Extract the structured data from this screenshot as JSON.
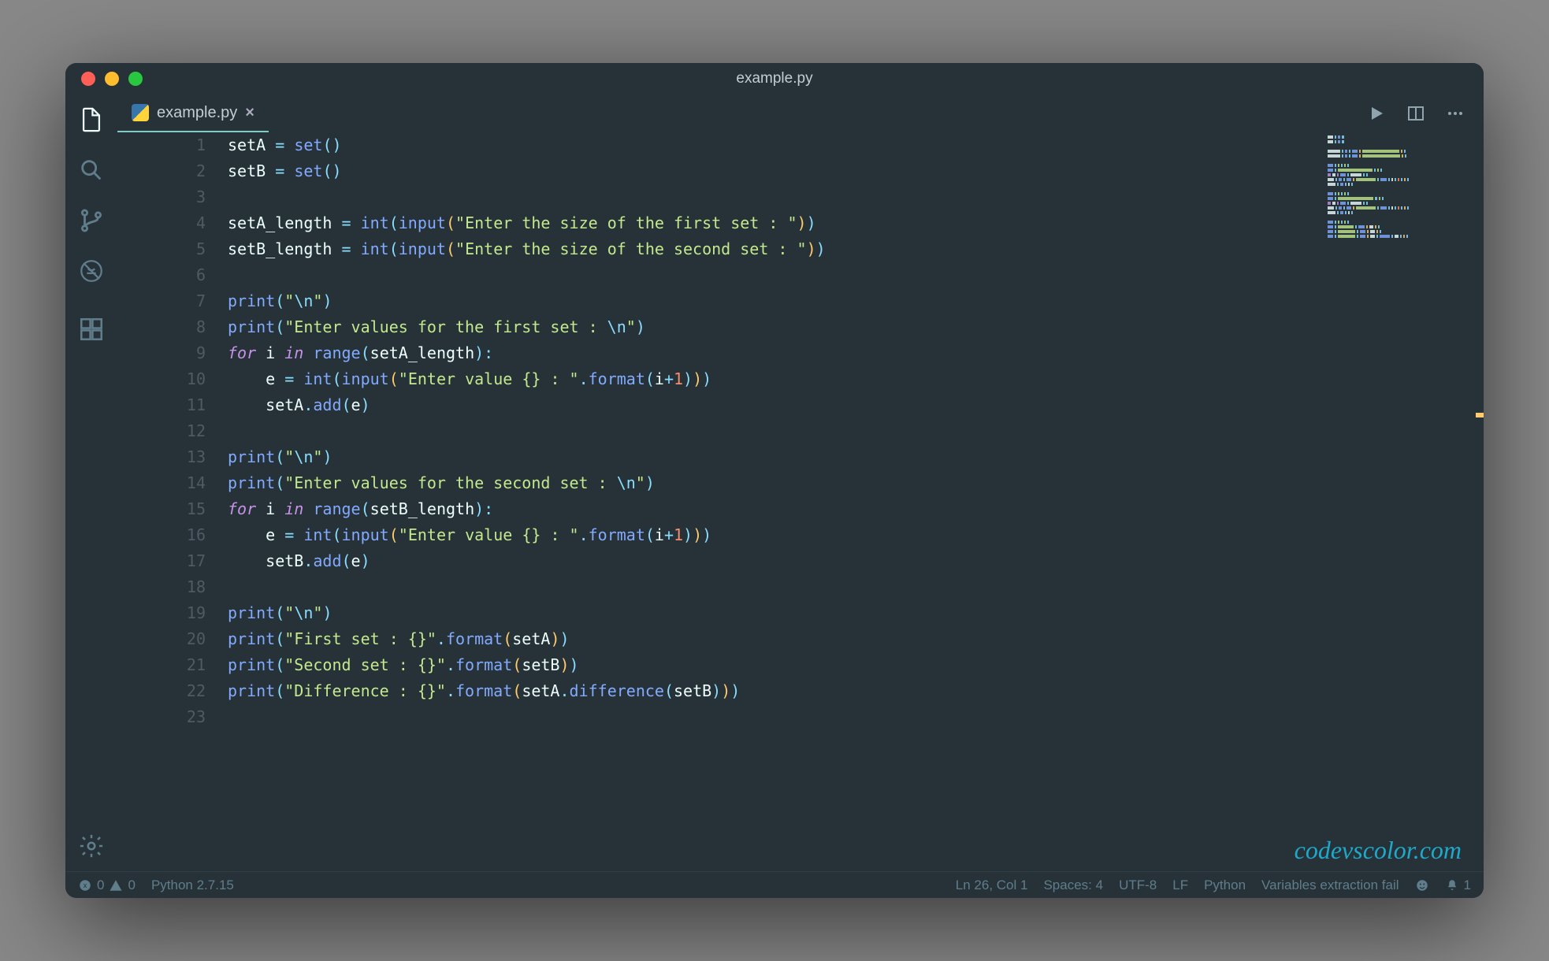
{
  "window": {
    "title": "example.py"
  },
  "tab": {
    "filename": "example.py"
  },
  "code_lines": [
    {
      "n": 1,
      "tokens": [
        {
          "t": "setA ",
          "c": "tk-var"
        },
        {
          "t": "=",
          "c": "tk-op"
        },
        {
          "t": " ",
          "c": ""
        },
        {
          "t": "set",
          "c": "tk-fn"
        },
        {
          "t": "()",
          "c": "tk-punc"
        }
      ]
    },
    {
      "n": 2,
      "tokens": [
        {
          "t": "setB ",
          "c": "tk-var"
        },
        {
          "t": "=",
          "c": "tk-op"
        },
        {
          "t": " ",
          "c": ""
        },
        {
          "t": "set",
          "c": "tk-fn"
        },
        {
          "t": "()",
          "c": "tk-punc"
        }
      ]
    },
    {
      "n": 3,
      "tokens": []
    },
    {
      "n": 4,
      "tokens": [
        {
          "t": "setA_length ",
          "c": "tk-var"
        },
        {
          "t": "=",
          "c": "tk-op"
        },
        {
          "t": " ",
          "c": ""
        },
        {
          "t": "int",
          "c": "tk-fn"
        },
        {
          "t": "(",
          "c": "tk-punc"
        },
        {
          "t": "input",
          "c": "tk-call"
        },
        {
          "t": "(",
          "c": "tk-paren"
        },
        {
          "t": "\"Enter the size of the first set : \"",
          "c": "tk-str"
        },
        {
          "t": ")",
          "c": "tk-paren"
        },
        {
          "t": ")",
          "c": "tk-punc"
        }
      ]
    },
    {
      "n": 5,
      "tokens": [
        {
          "t": "setB_length ",
          "c": "tk-var"
        },
        {
          "t": "=",
          "c": "tk-op"
        },
        {
          "t": " ",
          "c": ""
        },
        {
          "t": "int",
          "c": "tk-fn"
        },
        {
          "t": "(",
          "c": "tk-punc"
        },
        {
          "t": "input",
          "c": "tk-call"
        },
        {
          "t": "(",
          "c": "tk-paren"
        },
        {
          "t": "\"Enter the size of the second set : \"",
          "c": "tk-str"
        },
        {
          "t": ")",
          "c": "tk-paren"
        },
        {
          "t": ")",
          "c": "tk-punc"
        }
      ]
    },
    {
      "n": 6,
      "tokens": []
    },
    {
      "n": 7,
      "tokens": [
        {
          "t": "print",
          "c": "tk-fn"
        },
        {
          "t": "(",
          "c": "tk-punc"
        },
        {
          "t": "\"",
          "c": "tk-str"
        },
        {
          "t": "\\n",
          "c": "tk-esc"
        },
        {
          "t": "\"",
          "c": "tk-str"
        },
        {
          "t": ")",
          "c": "tk-punc"
        }
      ]
    },
    {
      "n": 8,
      "tokens": [
        {
          "t": "print",
          "c": "tk-fn"
        },
        {
          "t": "(",
          "c": "tk-punc"
        },
        {
          "t": "\"Enter values for the first set : ",
          "c": "tk-str"
        },
        {
          "t": "\\n",
          "c": "tk-esc"
        },
        {
          "t": "\"",
          "c": "tk-str"
        },
        {
          "t": ")",
          "c": "tk-punc"
        }
      ]
    },
    {
      "n": 9,
      "tokens": [
        {
          "t": "for",
          "c": "tk-kw"
        },
        {
          "t": " i ",
          "c": "tk-var"
        },
        {
          "t": "in",
          "c": "tk-kw"
        },
        {
          "t": " ",
          "c": ""
        },
        {
          "t": "range",
          "c": "tk-fn"
        },
        {
          "t": "(",
          "c": "tk-punc"
        },
        {
          "t": "setA_length",
          "c": "tk-var"
        },
        {
          "t": ")",
          "c": "tk-punc"
        },
        {
          "t": ":",
          "c": "tk-punc"
        }
      ]
    },
    {
      "n": 10,
      "tokens": [
        {
          "t": "    e ",
          "c": "tk-var"
        },
        {
          "t": "=",
          "c": "tk-op"
        },
        {
          "t": " ",
          "c": ""
        },
        {
          "t": "int",
          "c": "tk-fn"
        },
        {
          "t": "(",
          "c": "tk-punc"
        },
        {
          "t": "input",
          "c": "tk-call"
        },
        {
          "t": "(",
          "c": "tk-paren"
        },
        {
          "t": "\"Enter value {} : \"",
          "c": "tk-str"
        },
        {
          "t": ".",
          "c": "tk-punc"
        },
        {
          "t": "format",
          "c": "tk-call"
        },
        {
          "t": "(",
          "c": "tk-punc"
        },
        {
          "t": "i",
          "c": "tk-var"
        },
        {
          "t": "+",
          "c": "tk-op"
        },
        {
          "t": "1",
          "c": "tk-num"
        },
        {
          "t": ")",
          "c": "tk-punc"
        },
        {
          "t": ")",
          "c": "tk-paren"
        },
        {
          "t": ")",
          "c": "tk-punc"
        }
      ]
    },
    {
      "n": 11,
      "tokens": [
        {
          "t": "    setA",
          "c": "tk-var"
        },
        {
          "t": ".",
          "c": "tk-punc"
        },
        {
          "t": "add",
          "c": "tk-call"
        },
        {
          "t": "(",
          "c": "tk-punc"
        },
        {
          "t": "e",
          "c": "tk-var"
        },
        {
          "t": ")",
          "c": "tk-punc"
        }
      ]
    },
    {
      "n": 12,
      "tokens": []
    },
    {
      "n": 13,
      "tokens": [
        {
          "t": "print",
          "c": "tk-fn"
        },
        {
          "t": "(",
          "c": "tk-punc"
        },
        {
          "t": "\"",
          "c": "tk-str"
        },
        {
          "t": "\\n",
          "c": "tk-esc"
        },
        {
          "t": "\"",
          "c": "tk-str"
        },
        {
          "t": ")",
          "c": "tk-punc"
        }
      ]
    },
    {
      "n": 14,
      "tokens": [
        {
          "t": "print",
          "c": "tk-fn"
        },
        {
          "t": "(",
          "c": "tk-punc"
        },
        {
          "t": "\"Enter values for the second set : ",
          "c": "tk-str"
        },
        {
          "t": "\\n",
          "c": "tk-esc"
        },
        {
          "t": "\"",
          "c": "tk-str"
        },
        {
          "t": ")",
          "c": "tk-punc"
        }
      ]
    },
    {
      "n": 15,
      "tokens": [
        {
          "t": "for",
          "c": "tk-kw"
        },
        {
          "t": " i ",
          "c": "tk-var"
        },
        {
          "t": "in",
          "c": "tk-kw"
        },
        {
          "t": " ",
          "c": ""
        },
        {
          "t": "range",
          "c": "tk-fn"
        },
        {
          "t": "(",
          "c": "tk-punc"
        },
        {
          "t": "setB_length",
          "c": "tk-var"
        },
        {
          "t": ")",
          "c": "tk-punc"
        },
        {
          "t": ":",
          "c": "tk-punc"
        }
      ]
    },
    {
      "n": 16,
      "tokens": [
        {
          "t": "    e ",
          "c": "tk-var"
        },
        {
          "t": "=",
          "c": "tk-op"
        },
        {
          "t": " ",
          "c": ""
        },
        {
          "t": "int",
          "c": "tk-fn"
        },
        {
          "t": "(",
          "c": "tk-punc"
        },
        {
          "t": "input",
          "c": "tk-call"
        },
        {
          "t": "(",
          "c": "tk-paren"
        },
        {
          "t": "\"Enter value {} : \"",
          "c": "tk-str"
        },
        {
          "t": ".",
          "c": "tk-punc"
        },
        {
          "t": "format",
          "c": "tk-call"
        },
        {
          "t": "(",
          "c": "tk-punc"
        },
        {
          "t": "i",
          "c": "tk-var"
        },
        {
          "t": "+",
          "c": "tk-op"
        },
        {
          "t": "1",
          "c": "tk-num"
        },
        {
          "t": ")",
          "c": "tk-punc"
        },
        {
          "t": ")",
          "c": "tk-paren"
        },
        {
          "t": ")",
          "c": "tk-punc"
        }
      ]
    },
    {
      "n": 17,
      "tokens": [
        {
          "t": "    setB",
          "c": "tk-var"
        },
        {
          "t": ".",
          "c": "tk-punc"
        },
        {
          "t": "add",
          "c": "tk-call"
        },
        {
          "t": "(",
          "c": "tk-punc"
        },
        {
          "t": "e",
          "c": "tk-var"
        },
        {
          "t": ")",
          "c": "tk-punc"
        }
      ]
    },
    {
      "n": 18,
      "tokens": []
    },
    {
      "n": 19,
      "tokens": [
        {
          "t": "print",
          "c": "tk-fn"
        },
        {
          "t": "(",
          "c": "tk-punc"
        },
        {
          "t": "\"",
          "c": "tk-str"
        },
        {
          "t": "\\n",
          "c": "tk-esc"
        },
        {
          "t": "\"",
          "c": "tk-str"
        },
        {
          "t": ")",
          "c": "tk-punc"
        }
      ]
    },
    {
      "n": 20,
      "tokens": [
        {
          "t": "print",
          "c": "tk-fn"
        },
        {
          "t": "(",
          "c": "tk-punc"
        },
        {
          "t": "\"First set : {}\"",
          "c": "tk-str"
        },
        {
          "t": ".",
          "c": "tk-punc"
        },
        {
          "t": "format",
          "c": "tk-call"
        },
        {
          "t": "(",
          "c": "tk-paren"
        },
        {
          "t": "setA",
          "c": "tk-var"
        },
        {
          "t": ")",
          "c": "tk-paren"
        },
        {
          "t": ")",
          "c": "tk-punc"
        }
      ]
    },
    {
      "n": 21,
      "tokens": [
        {
          "t": "print",
          "c": "tk-fn"
        },
        {
          "t": "(",
          "c": "tk-punc"
        },
        {
          "t": "\"Second set : {}\"",
          "c": "tk-str"
        },
        {
          "t": ".",
          "c": "tk-punc"
        },
        {
          "t": "format",
          "c": "tk-call"
        },
        {
          "t": "(",
          "c": "tk-paren"
        },
        {
          "t": "setB",
          "c": "tk-var"
        },
        {
          "t": ")",
          "c": "tk-paren"
        },
        {
          "t": ")",
          "c": "tk-punc"
        }
      ]
    },
    {
      "n": 22,
      "tokens": [
        {
          "t": "print",
          "c": "tk-fn"
        },
        {
          "t": "(",
          "c": "tk-punc"
        },
        {
          "t": "\"Difference : {}\"",
          "c": "tk-str"
        },
        {
          "t": ".",
          "c": "tk-punc"
        },
        {
          "t": "format",
          "c": "tk-call"
        },
        {
          "t": "(",
          "c": "tk-paren"
        },
        {
          "t": "setA",
          "c": "tk-var"
        },
        {
          "t": ".",
          "c": "tk-punc"
        },
        {
          "t": "difference",
          "c": "tk-call"
        },
        {
          "t": "(",
          "c": "tk-punc"
        },
        {
          "t": "setB",
          "c": "tk-var"
        },
        {
          "t": ")",
          "c": "tk-punc"
        },
        {
          "t": ")",
          "c": "tk-paren"
        },
        {
          "t": ")",
          "c": "tk-punc"
        }
      ]
    },
    {
      "n": 23,
      "tokens": []
    }
  ],
  "statusbar": {
    "errors": "0",
    "warnings": "0",
    "interpreter": "Python 2.7.15",
    "cursor": "Ln 26, Col 1",
    "spaces": "Spaces: 4",
    "encoding": "UTF-8",
    "eol": "LF",
    "language": "Python",
    "extra": "Variables extraction fail",
    "notifications": "1"
  },
  "watermark": "codevscolor.com"
}
